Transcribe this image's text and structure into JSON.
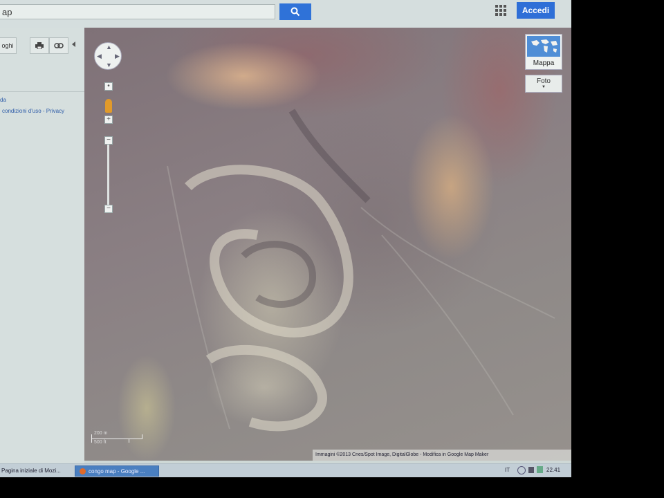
{
  "browser": {
    "search": {
      "value": "ap"
    },
    "signin_label": "Accedi"
  },
  "sidebar": {
    "places_label": "oghi",
    "link_1": "da",
    "link_2": "condizioni d'uso - Privacy"
  },
  "map": {
    "map_type_label": "Mappa",
    "photo_label": "Foto",
    "scale": {
      "top": "200 m",
      "bottom": "500 ft"
    },
    "attribution": "Immagini ©2013 Cnes/Spot Image, DigitalGlobe -  Modifica in Google Map Maker"
  },
  "taskbar": {
    "items": [
      {
        "label": "Pagina iniziale di Mozi..."
      },
      {
        "label": "congo map - Google ..."
      }
    ],
    "tray": {
      "lang": "IT",
      "time": "22.41"
    }
  },
  "colors": {
    "accent": "#2f72d8",
    "map_base": "#8a7f83"
  }
}
